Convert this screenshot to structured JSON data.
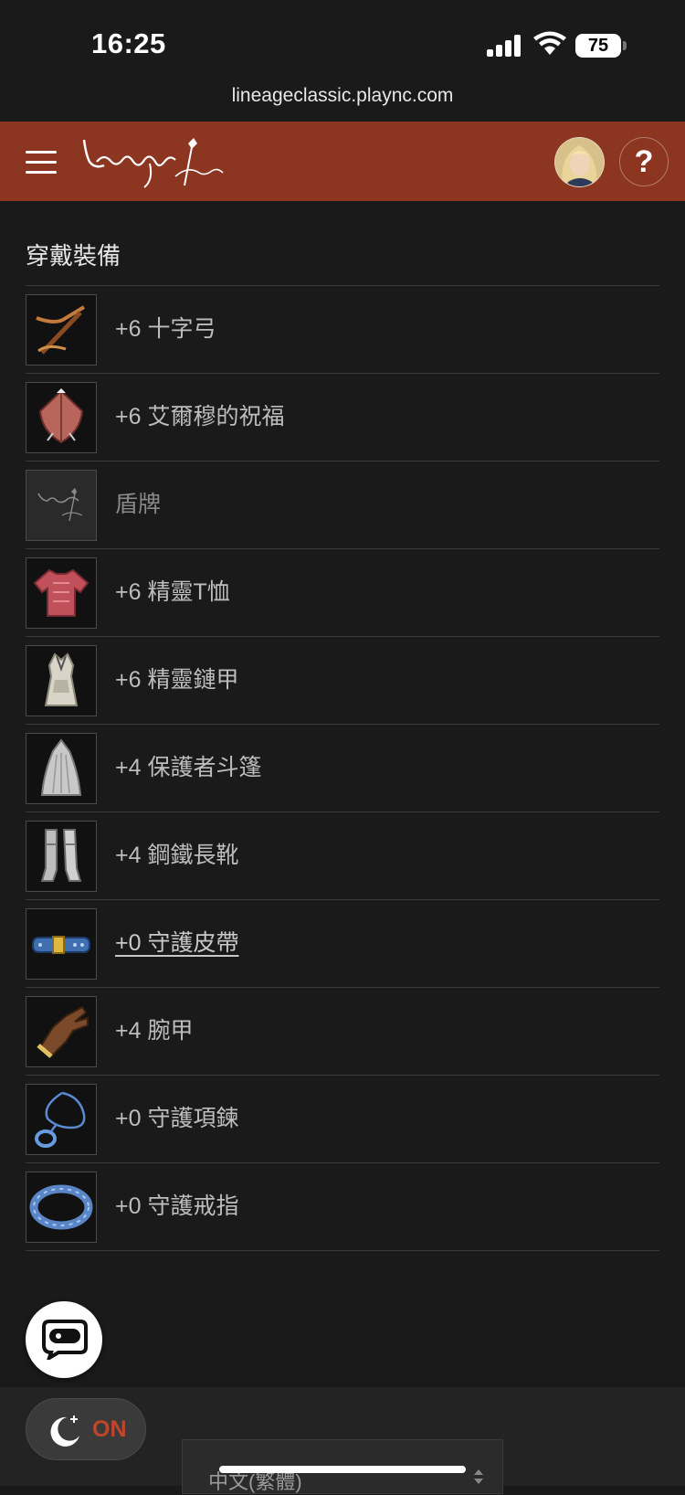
{
  "status": {
    "time": "16:25",
    "battery": "75"
  },
  "browser": {
    "url": "lineageclassic.plaync.com"
  },
  "header": {
    "logo_text": "Lineage Classic",
    "help_label": "?"
  },
  "section": {
    "title": "穿戴裝備"
  },
  "equipment": [
    {
      "name": "+6 十字弓",
      "icon": "crossbow-icon"
    },
    {
      "name": "+6 艾爾穆的祝福",
      "icon": "shield-icon"
    },
    {
      "name": "盾牌",
      "icon": "empty-slot-logo-icon"
    },
    {
      "name": "+6 精靈T恤",
      "icon": "tshirt-icon"
    },
    {
      "name": "+6 精靈鏈甲",
      "icon": "chainmail-icon"
    },
    {
      "name": "+4 保護者斗篷",
      "icon": "cloak-icon"
    },
    {
      "name": "+4 鋼鐵長靴",
      "icon": "boots-icon"
    },
    {
      "name": "+0 守護皮帶",
      "icon": "belt-icon"
    },
    {
      "name": "+4 腕甲",
      "icon": "glove-icon"
    },
    {
      "name": "+0 守護項鍊",
      "icon": "necklace-icon"
    },
    {
      "name": "+0 守護戒指",
      "icon": "ring-icon"
    }
  ],
  "footer": {
    "night_mode_label": "ON",
    "language": "中文(繁體)"
  },
  "colors": {
    "header_bg": "#8c3520",
    "accent": "#c0452b",
    "background": "#1a1a1a"
  }
}
